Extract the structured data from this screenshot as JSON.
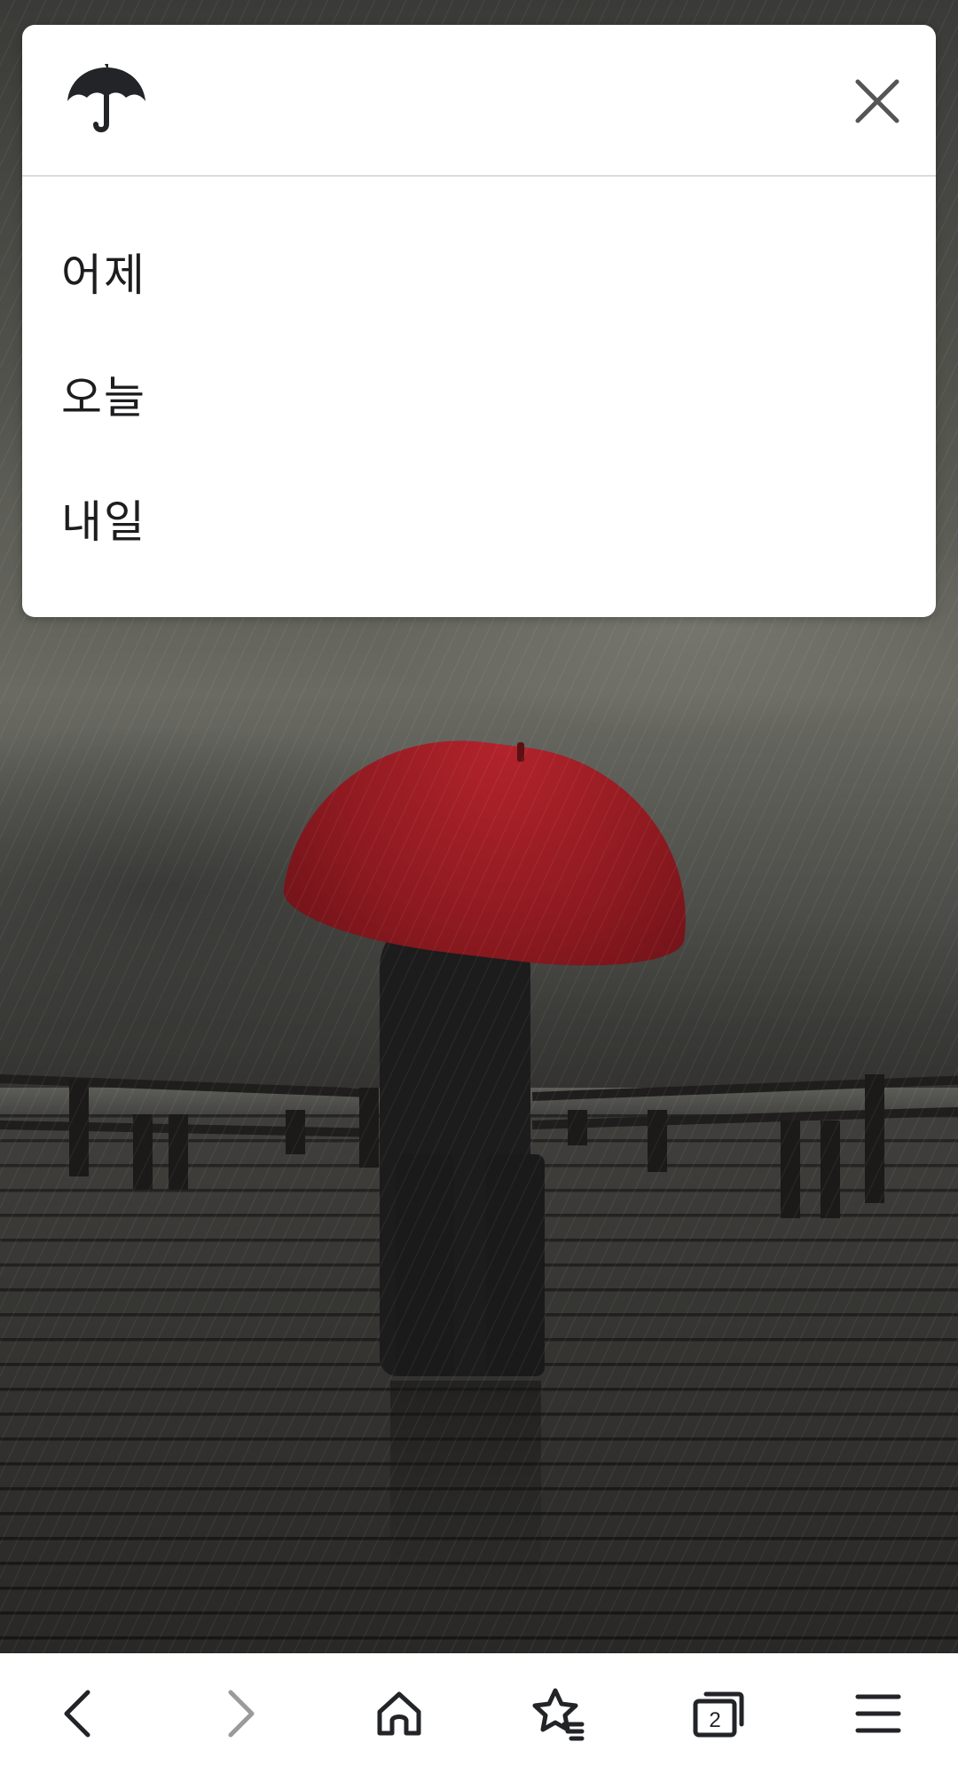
{
  "popup": {
    "icon": "umbrella-icon",
    "close_icon": "close-icon",
    "items": [
      {
        "label": "어제"
      },
      {
        "label": "오늘"
      },
      {
        "label": "내일"
      }
    ]
  },
  "navbar": {
    "back_icon": "chevron-left-icon",
    "forward_icon": "chevron-right-icon",
    "home_icon": "home-icon",
    "bookmarks_icon": "star-list-icon",
    "tabs_icon": "tabs-icon",
    "tabs_count": "2",
    "menu_icon": "hamburger-menu-icon"
  },
  "colors": {
    "popup_bg": "#ffffff",
    "text": "#1d1d1f",
    "icon": "#222428",
    "forward_disabled": "#9a9a9a",
    "umbrella_red": "#9b1d24"
  }
}
